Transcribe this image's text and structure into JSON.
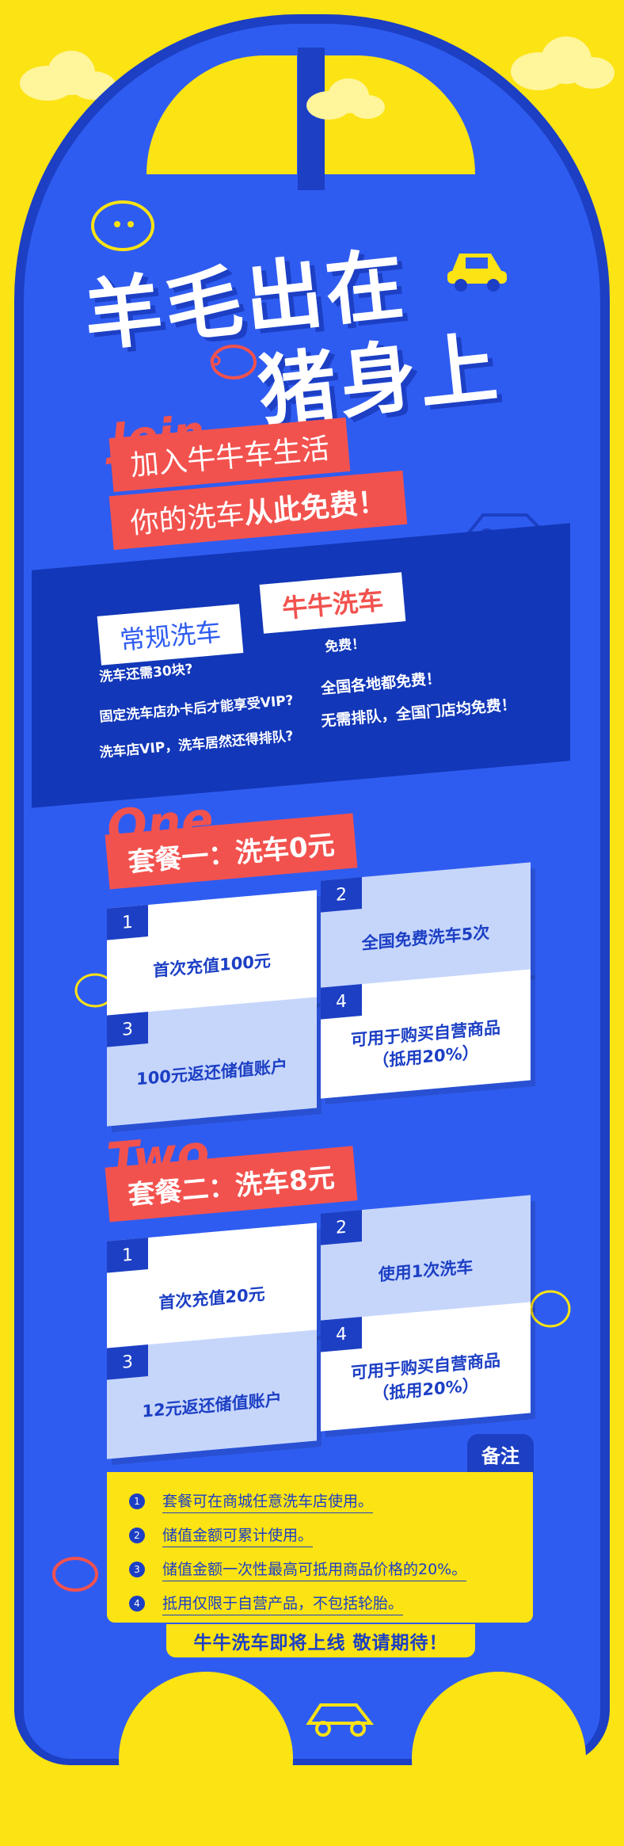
{
  "title": {
    "line1": "羊毛出在",
    "line2": "猪身上"
  },
  "intro": {
    "join_word": "Join",
    "line1": "加入牛牛车生活",
    "line2_prefix": "你的洗车",
    "line2_bold": "从此免费！"
  },
  "comparison": {
    "left_title": "常规洗车",
    "right_title": "牛牛洗车",
    "rows": [
      {
        "left": "洗车还需30块?",
        "right": "免费！"
      },
      {
        "left": "固定洗车店办卡后才能享受VIP?",
        "right": "全国各地都免费！"
      },
      {
        "left": "洗车店VIP，洗车居然还得排队?",
        "right": "无需排队，全国门店均免费！"
      }
    ]
  },
  "package1": {
    "word": "One",
    "title": "套餐一：洗车0元",
    "items": [
      {
        "num": "1",
        "text": "首次充值100元"
      },
      {
        "num": "2",
        "text": "全国免费洗车5次"
      },
      {
        "num": "3",
        "text": "100元返还储值账户"
      },
      {
        "num": "4",
        "text": "可用于购买自营商品（抵用20%）"
      }
    ]
  },
  "package2": {
    "word": "Two",
    "title": "套餐二：洗车8元",
    "items": [
      {
        "num": "1",
        "text": "首次充值20元"
      },
      {
        "num": "2",
        "text": "使用1次洗车"
      },
      {
        "num": "3",
        "text": "12元返还储值账户"
      },
      {
        "num": "4",
        "text": "可用于购买自营商品（抵用20%）"
      }
    ]
  },
  "notes": {
    "tag": "备注",
    "items": [
      {
        "num": "1",
        "text": "套餐可在商城任意洗车店使用。"
      },
      {
        "num": "2",
        "text": "储值金额可累计使用。"
      },
      {
        "num": "3",
        "text": "储值金额一次性最高可抵用商品价格的20%。"
      },
      {
        "num": "4",
        "text": "抵用仅限于自营产品，不包括轮胎。"
      }
    ]
  },
  "footer": "牛牛洗车即将上线 敬请期待！",
  "colors": {
    "yellow": "#fce314",
    "blue": "#2f5cf0",
    "dark_blue": "#1c3fc4",
    "red": "#f2524e"
  }
}
